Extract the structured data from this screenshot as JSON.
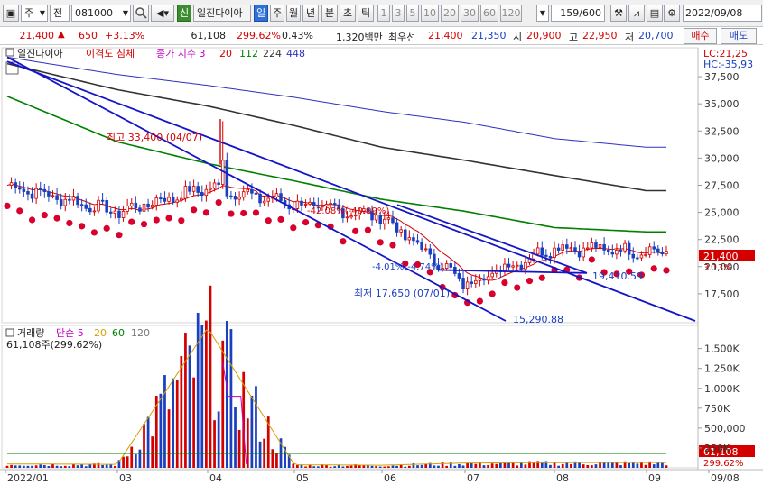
{
  "toolbar": {
    "market": "주",
    "period_type": "전",
    "code": "081000",
    "badge": "신",
    "stock_name": "일진다이아",
    "periods": [
      "일",
      "주",
      "월",
      "년",
      "분",
      "초",
      "틱"
    ],
    "active_period": "일",
    "ranges": [
      "1",
      "3",
      "5",
      "10",
      "20",
      "30",
      "60",
      "120"
    ],
    "count": "159/600",
    "date": "2022/09/08"
  },
  "infobar": {
    "price": "21,400",
    "change_arrow": "▲",
    "change": "650",
    "change_pct": "+3.13%",
    "volume": "61,108",
    "volume_pct": "299.62%",
    "turnover": "0.43%",
    "amount": "1,320백만",
    "best_ask_label": "최우선",
    "best_ask": "21,400",
    "best_bid": "21,350",
    "open_label": "시",
    "open": "20,900",
    "high_label": "고",
    "high": "22,950",
    "low_label": "저",
    "low": "20,700",
    "buy_label": "매수",
    "sell_label": "매도"
  },
  "price_panel": {
    "legend_name": "일진다이아",
    "legend_indicator": "이격도 침체",
    "legend_ma": "종가 지수 3",
    "ma_periods": [
      "20",
      "112",
      "224",
      "448"
    ],
    "lc_label": "LC:21,25",
    "hc_label": "HC:-35,93",
    "high_annot": "최고 33,400 (04/07)",
    "low_annot": "최저 17,650 (07/01)",
    "disparity_annot_1": "-42.08%(-40.99%)",
    "disparity_annot_2": "-4.01%(-4.74%)",
    "trend_value_1": "19,410.59",
    "trend_value_2": "15,290.88",
    "current_price_label": "21,400",
    "current_pct_label": "3.13%"
  },
  "volume_panel": {
    "legend_name": "거래량",
    "legend_ma": "단순 5",
    "ma_periods": [
      "20",
      "60",
      "120"
    ],
    "subtitle": "61,108주(299.62%)",
    "current_volume_label": "61,108",
    "current_pct_label": "299.62%"
  },
  "colors": {
    "up": "#d40000",
    "down": "#1a3fbf",
    "ma20": "#d40000",
    "ma112": "#008000",
    "ma224": "#333333",
    "ma448": "#3030c0",
    "trend": "#1515c8",
    "signal_dot": "#d8002c"
  },
  "chart_data": [
    {
      "type": "candlestick",
      "title": "일진다이아",
      "x": [
        "2022/01",
        "03",
        "04",
        "05",
        "06",
        "07",
        "08",
        "09"
      ],
      "x_tick_labels": [
        "2022/01",
        "03",
        "04",
        "05",
        "06",
        "07",
        "08",
        "09",
        "09/08"
      ],
      "y_tick_labels": [
        "17,500",
        "20,000",
        "22,500",
        "25,000",
        "27,500",
        "30,000",
        "32,500",
        "35,000",
        "37,500"
      ],
      "ylim": [
        15000,
        39500
      ],
      "series": [
        {
          "name": "종가",
          "x": [
            "2022/01",
            "03",
            "04",
            "05",
            "06",
            "07",
            "08",
            "09"
          ],
          "values": [
            27500,
            25000,
            27300,
            25800,
            24600,
            18400,
            21800,
            21400
          ]
        },
        {
          "name": "224",
          "x": [
            "2022/01",
            "03",
            "04",
            "05",
            "06",
            "07",
            "08",
            "09"
          ],
          "values": [
            38700,
            36300,
            34800,
            33000,
            31000,
            29800,
            28400,
            27000
          ]
        },
        {
          "name": "112",
          "x": [
            "2022/01",
            "03",
            "04",
            "05",
            "06",
            "07",
            "08",
            "09"
          ],
          "values": [
            35700,
            31500,
            29500,
            27900,
            26200,
            25100,
            23600,
            23200
          ]
        },
        {
          "name": "448",
          "x": [
            "2022/01",
            "03",
            "04",
            "05",
            "06",
            "07",
            "08",
            "09"
          ],
          "values": [
            39300,
            37700,
            36700,
            35600,
            34300,
            33300,
            31800,
            31000
          ]
        }
      ],
      "annotations": [
        {
          "text": "최고 33,400 (04/07)",
          "x": "04",
          "y": 33400
        },
        {
          "text": "최저 17,650 (07/01)",
          "x": "07",
          "y": 17650
        },
        {
          "text": "19,410.59",
          "y": 19410.59
        },
        {
          "text": "15,290.88",
          "y": 15290.88
        }
      ],
      "grid": false,
      "legend": "top-left"
    },
    {
      "type": "bar",
      "title": "거래량",
      "x": [
        "2022/01",
        "03",
        "04",
        "05",
        "06",
        "07",
        "08",
        "09"
      ],
      "y_tick_labels": [
        "250K",
        "500,000",
        "750K",
        "1,000K",
        "1,250K",
        "1,500K"
      ],
      "ylim": [
        0,
        1700000
      ],
      "series": [
        {
          "name": "거래량",
          "x": [
            "2022/01",
            "03",
            "04",
            "05",
            "06",
            "07",
            "08",
            "09"
          ],
          "values": [
            45000,
            40000,
            1600000,
            35000,
            30000,
            55000,
            60000,
            61108
          ]
        }
      ],
      "grid": false,
      "legend": "top-left"
    }
  ]
}
